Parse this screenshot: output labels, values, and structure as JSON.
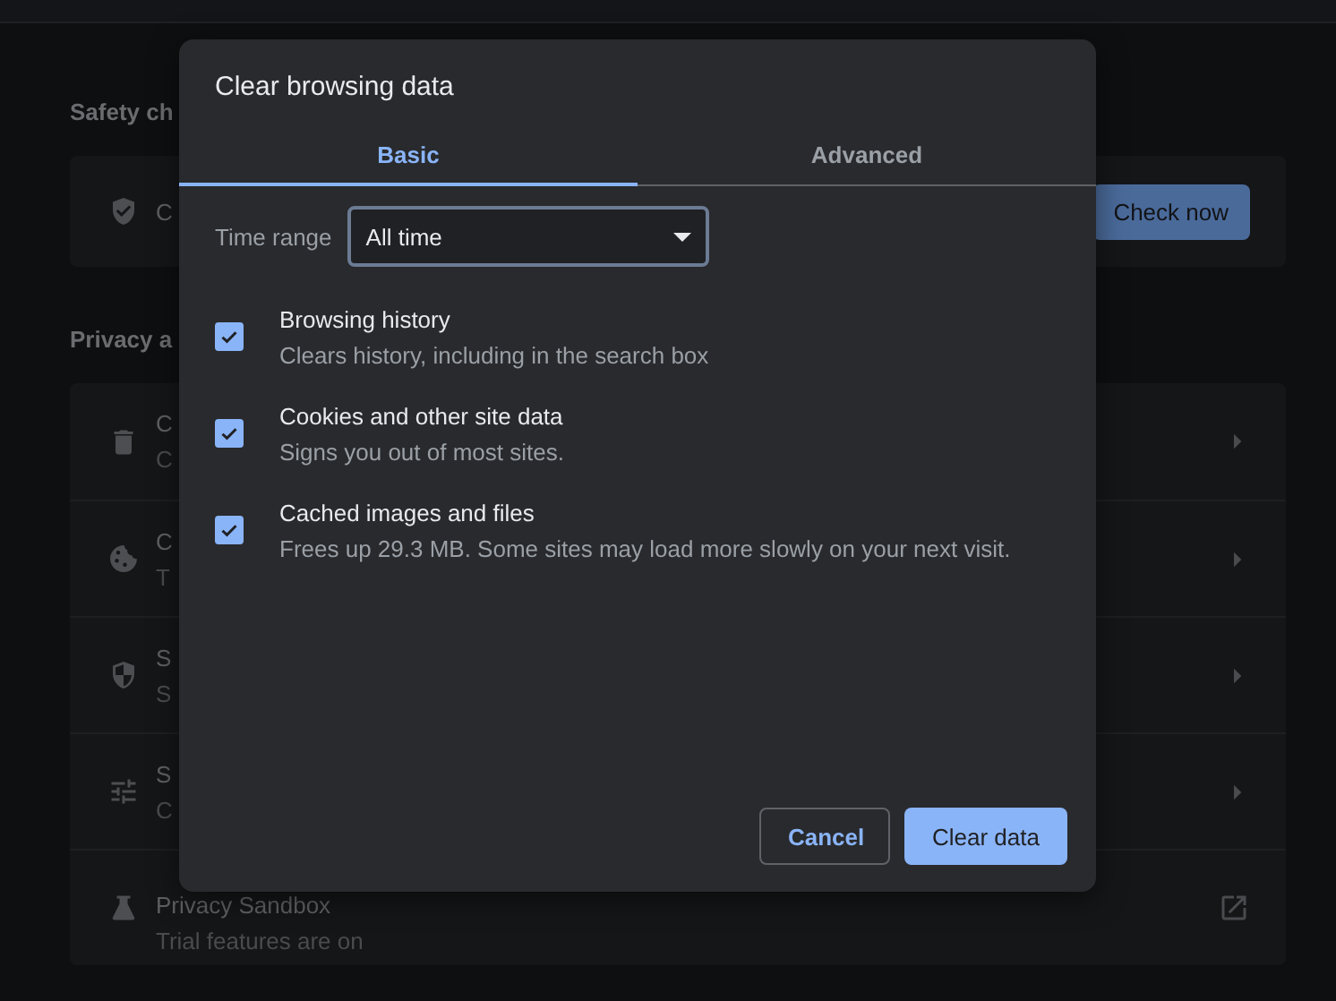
{
  "settings": {
    "sections": [
      {
        "heading": "Safety ch",
        "rows": [
          {
            "title": "C",
            "button": "Check now"
          }
        ]
      },
      {
        "heading": "Privacy a",
        "rows": [
          {
            "title": "C",
            "subtitle": "C"
          },
          {
            "title": "C",
            "subtitle": "T"
          },
          {
            "title": "S",
            "subtitle": "S"
          },
          {
            "title": "S",
            "subtitle": "C"
          },
          {
            "title": "Privacy Sandbox",
            "subtitle": "Trial features are on"
          }
        ]
      }
    ]
  },
  "dialog": {
    "title": "Clear browsing data",
    "tabs": [
      {
        "label": "Basic",
        "selected": true
      },
      {
        "label": "Advanced",
        "selected": false
      }
    ],
    "time_range": {
      "label": "Time range",
      "value": "All time"
    },
    "items": [
      {
        "title": "Browsing history",
        "description": "Clears history, including in the search box",
        "checked": true
      },
      {
        "title": "Cookies and other site data",
        "description": "Signs you out of most sites.",
        "checked": true
      },
      {
        "title": "Cached images and files",
        "description": "Frees up 29.3 MB. Some sites may load more slowly on your next visit.",
        "checked": true
      }
    ],
    "buttons": [
      {
        "label": "Cancel",
        "kind": "secondary"
      },
      {
        "label": "Clear data",
        "kind": "primary"
      }
    ]
  }
}
